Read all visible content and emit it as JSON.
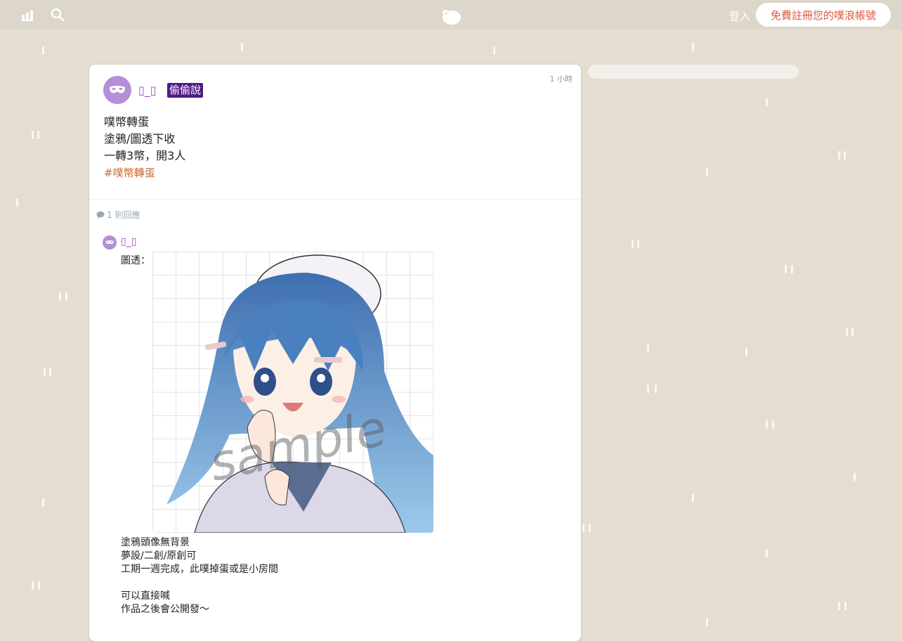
{
  "header": {
    "login_label": "登入",
    "signup_label": "免費註冊您的噗浪帳號"
  },
  "post": {
    "author": "▯_▯",
    "badge": "偷偷說",
    "time": "1 小時",
    "lines": [
      "噗幣轉蛋",
      "塗鴉/圖透下收",
      "一轉3幣，開3人"
    ],
    "hashtag": "#噗幣轉蛋",
    "reply_count": "1 則回應"
  },
  "reply": {
    "author": "▯_▯",
    "label": "圖透：",
    "image_watermark": "sample",
    "text": "塗鴉頭像無背景\n夢設/二創/原創可\n工期一週完成，此噗掉蛋或是小房間\n\n可以直接喊\n作品之後會公開發～"
  },
  "colors": {
    "background": "#e6ddd1",
    "topbar": "#ddd6cb",
    "accent_orange": "#e0583c",
    "badge": "#521a88",
    "author": "#a14bbd",
    "hashtag": "#d26a2c"
  },
  "icons": [
    "stats-icon",
    "search-icon",
    "plurk-logo-icon",
    "comment-bubble-icon",
    "mask-avatar-icon"
  ]
}
